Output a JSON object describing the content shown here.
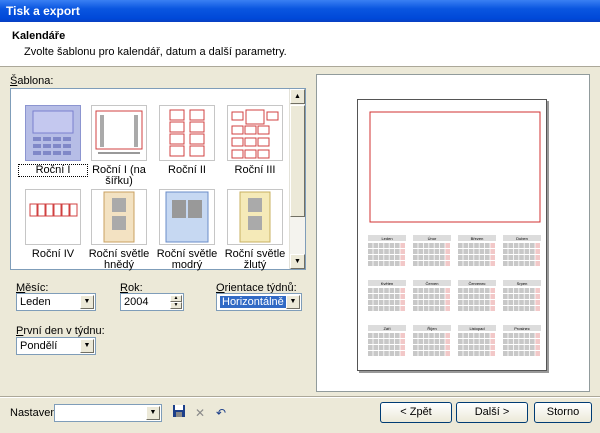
{
  "window": {
    "title": "Tisk a export"
  },
  "header": {
    "title": "Kalendáře",
    "subtitle": "Zvolte šablonu pro kalendář, datum a další parametry."
  },
  "templates": {
    "label_prefix": "Š",
    "label_rest": "ablona:",
    "items": [
      {
        "label": "Roční I",
        "selected": true
      },
      {
        "label": "Roční I (na šířku)"
      },
      {
        "label": "Roční II"
      },
      {
        "label": "Roční III"
      },
      {
        "label": "Roční IV"
      },
      {
        "label": "Roční světle hnědý"
      },
      {
        "label": "Roční světle modrý"
      },
      {
        "label": "Roční světle žlutý"
      }
    ]
  },
  "fields": {
    "month": {
      "label_u": "M",
      "label_rest": "ěsíc:",
      "value": "Leden"
    },
    "year": {
      "label_u": "R",
      "label_rest": "ok:",
      "value": "2004"
    },
    "orientation": {
      "label_u": "O",
      "label_rest": "rientace týdnů:",
      "value": "Horizontálně"
    },
    "first_day": {
      "label_u": "P",
      "label_rest": "rvní den v týdnu:",
      "value": "Pondělí"
    }
  },
  "preview": {
    "months": [
      "Leden",
      "Únor",
      "Březen",
      "Duben",
      "Květen",
      "Červen",
      "Červenec",
      "Srpen",
      "Září",
      "Říjen",
      "Listopad",
      "Prosinec"
    ]
  },
  "bottom": {
    "settings_label": "Nastavení:",
    "settings_value": "",
    "back_label": "< Zpět",
    "next_label": "Další >",
    "cancel_label": "Storno"
  },
  "colors": {
    "title_bar": "#0a56e0",
    "selection": "#316ac5",
    "accent_red": "#d03030"
  }
}
